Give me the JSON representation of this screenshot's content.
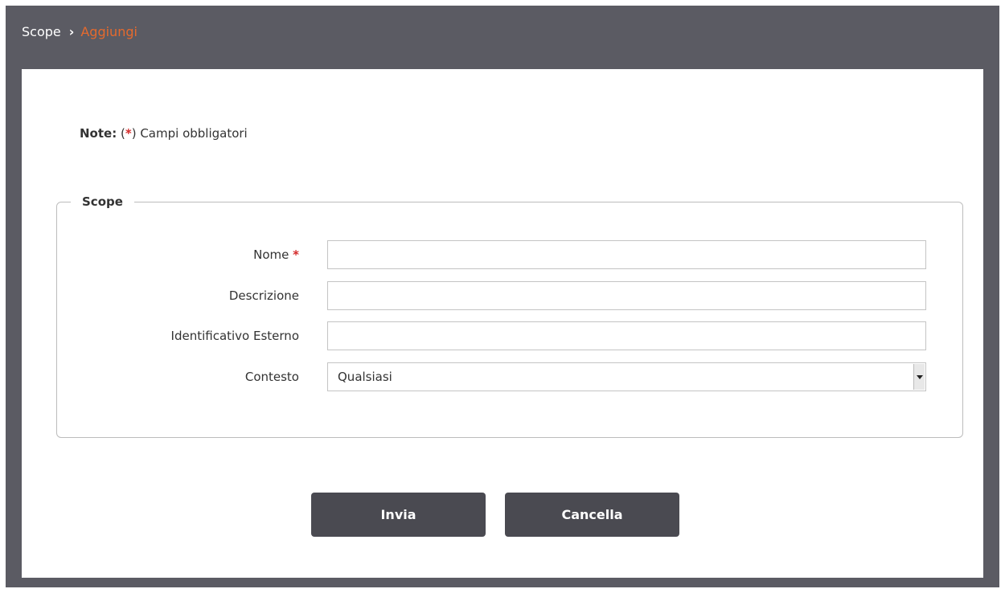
{
  "breadcrumb": {
    "root": "Scope",
    "separator": "›",
    "current": "Aggiungi"
  },
  "note": {
    "label": "Note:",
    "open": "(",
    "star": "*",
    "close": ")",
    "text": " Campi obbligatori"
  },
  "fieldset": {
    "legend": "Scope",
    "fields": [
      {
        "label": "Nome",
        "required_mark": "*",
        "value": ""
      },
      {
        "label": "Descrizione",
        "value": ""
      },
      {
        "label": "Identificativo Esterno",
        "value": ""
      },
      {
        "label": "Contesto",
        "selected": "Qualsiasi"
      }
    ]
  },
  "buttons": {
    "submit": "Invia",
    "cancel": "Cancella"
  },
  "colors": {
    "header_bg": "#5b5b63",
    "accent": "#e56a2e",
    "button_bg": "#4a4a51",
    "required": "#d42a2a"
  }
}
